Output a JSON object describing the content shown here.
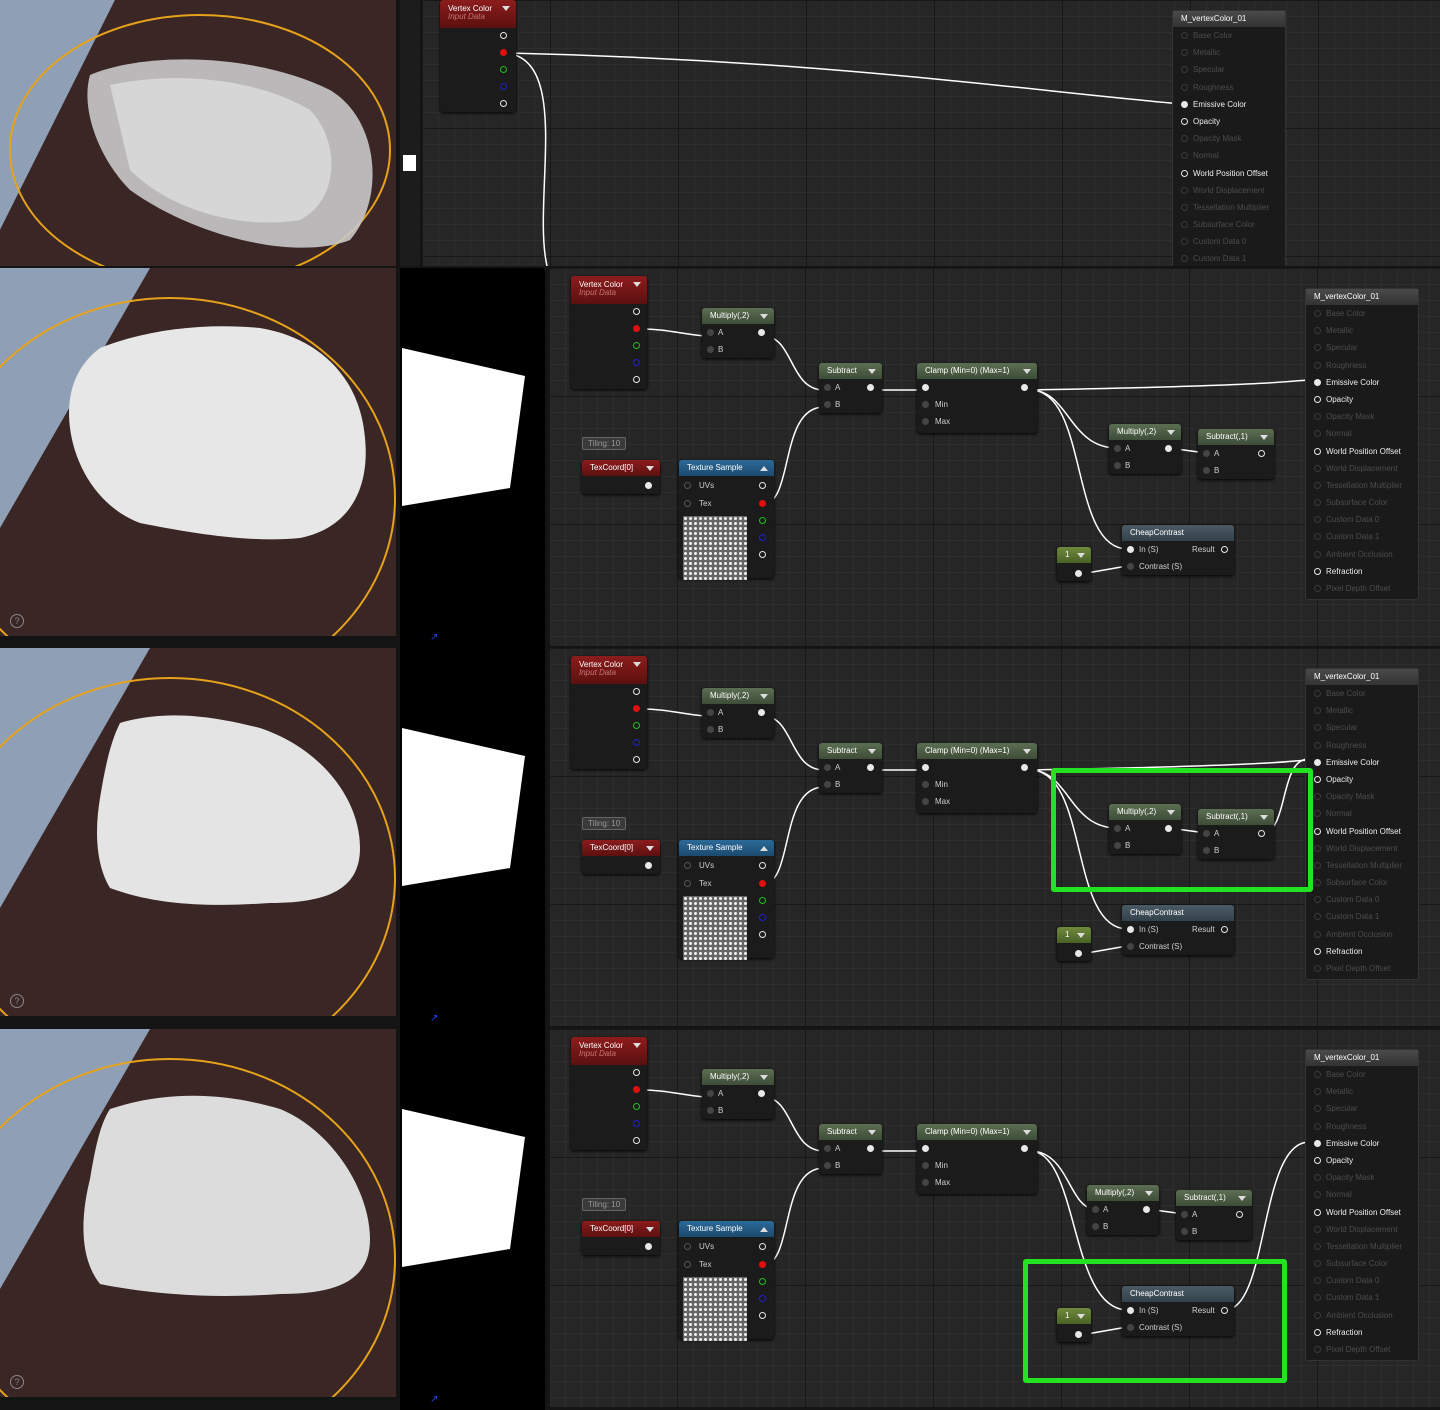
{
  "panels": [
    {
      "id": "p0",
      "vertex_pin": "red",
      "highlight": "none"
    },
    {
      "id": "p1",
      "vertex_pin": "red",
      "highlight": "none"
    },
    {
      "id": "p2",
      "vertex_pin": "green",
      "highlight": "multiply_subtract"
    },
    {
      "id": "p3",
      "vertex_pin": "red",
      "highlight": "cheapcontrast"
    }
  ],
  "nodes": {
    "vertex_color": {
      "title": "Vertex Color",
      "subtitle": "Input Data"
    },
    "multiply": {
      "title": "Multiply(,2)",
      "pin_a": "A",
      "pin_b": "B"
    },
    "subtract": {
      "title": "Subtract",
      "pin_a": "A",
      "pin_b": "B"
    },
    "clamp": {
      "title": "Clamp (Min=0) (Max=1)",
      "pin_min": "Min",
      "pin_max": "Max"
    },
    "tiling_comment": "Tiling: 10",
    "texcoord": {
      "title": "TexCoord[0]"
    },
    "texture_sample": {
      "title": "Texture Sample",
      "pin_uvs": "UVs",
      "pin_tex": "Tex"
    },
    "multiply2": {
      "title": "Multiply(,2)",
      "pin_a": "A",
      "pin_b": "B"
    },
    "subtract1": {
      "title": "Subtract(,1)",
      "pin_a": "A",
      "pin_b": "B"
    },
    "cheapcontrast": {
      "title": "CheapContrast",
      "pin_in": "In (S)",
      "pin_contrast": "Contrast (S)",
      "pin_result": "Result"
    },
    "constant": {
      "title": "1"
    }
  },
  "material": {
    "title": "M_vertexColor_01",
    "inputs": [
      {
        "label": "Base Color",
        "active": false
      },
      {
        "label": "Metallic",
        "active": false
      },
      {
        "label": "Specular",
        "active": false
      },
      {
        "label": "Roughness",
        "active": false
      },
      {
        "label": "Emissive Color",
        "active": true,
        "connected": true
      },
      {
        "label": "Opacity",
        "active": true
      },
      {
        "label": "Opacity Mask",
        "active": false
      },
      {
        "label": "Normal",
        "active": false
      },
      {
        "label": "World Position Offset",
        "active": true
      },
      {
        "label": "World Displacement",
        "active": false
      },
      {
        "label": "Tessellation Multiplier",
        "active": false
      },
      {
        "label": "Subsurface Color",
        "active": false
      },
      {
        "label": "Custom Data 0",
        "active": false
      },
      {
        "label": "Custom Data 1",
        "active": false
      },
      {
        "label": "Ambient Occlusion",
        "active": false
      },
      {
        "label": "Refraction",
        "active": true
      },
      {
        "label": "Pixel Depth Offset",
        "active": false
      }
    ]
  },
  "colors": {
    "highlight": "#22e222",
    "wire": "#ffffff",
    "viewport_outline": "#e6a21a"
  }
}
